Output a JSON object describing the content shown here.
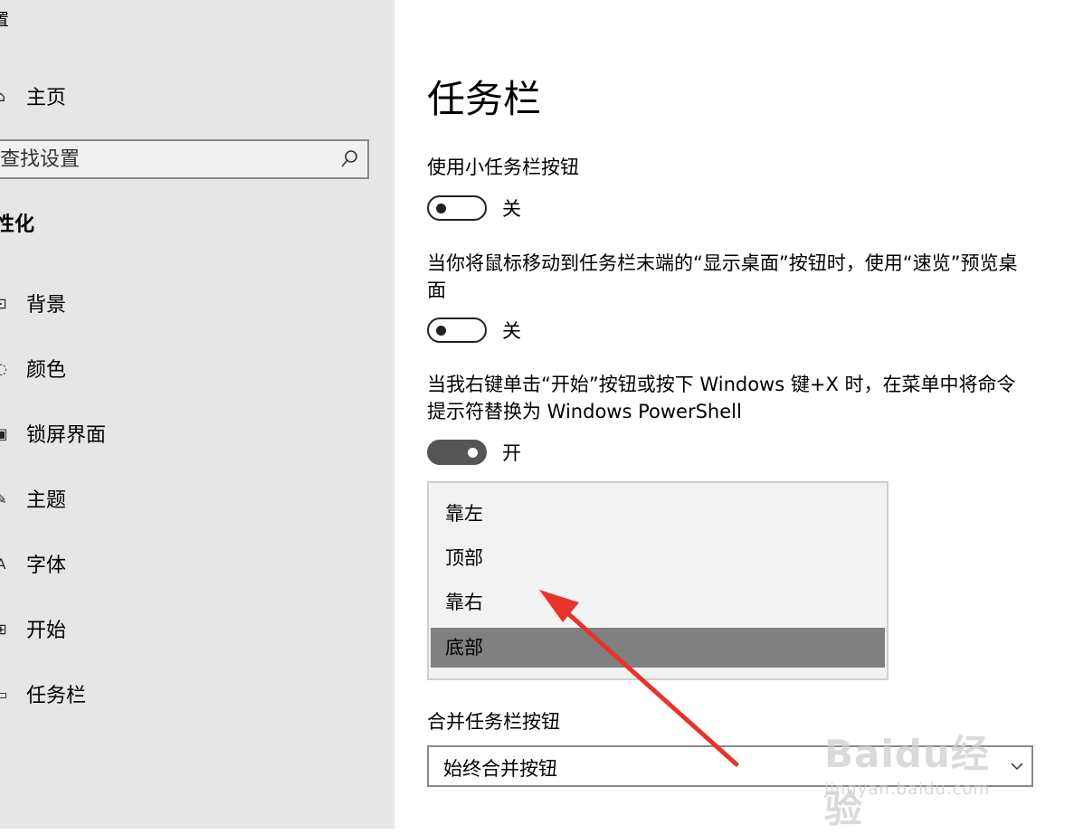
{
  "app": {
    "title": "置"
  },
  "sidebar": {
    "home_label": "主页",
    "search_placeholder": "查找设置",
    "section_title": "性化",
    "items": [
      {
        "label": "背景",
        "icon": "picture-icon"
      },
      {
        "label": "颜色",
        "icon": "palette-icon"
      },
      {
        "label": "锁屏界面",
        "icon": "lockscreen-icon"
      },
      {
        "label": "主题",
        "icon": "brush-icon"
      },
      {
        "label": "字体",
        "icon": "font-icon"
      },
      {
        "label": "开始",
        "icon": "start-icon"
      },
      {
        "label": "任务栏",
        "icon": "taskbar-icon"
      }
    ]
  },
  "main": {
    "title": "任务栏",
    "settings": [
      {
        "label": "使用小任务栏按钮",
        "state": "关",
        "on": false
      },
      {
        "label": "当你将鼠标移动到任务栏末端的“显示桌面”按钮时，使用“速览”预览桌面",
        "state": "关",
        "on": false
      },
      {
        "label": "当我右键单击“开始”按钮或按下 Windows 键+X 时，在菜单中将命令提示符替换为 Windows PowerShell",
        "state": "开",
        "on": true
      }
    ],
    "position_menu": {
      "options": [
        "靠左",
        "顶部",
        "靠右",
        "底部"
      ],
      "selected": "底部"
    },
    "combine": {
      "label": "合并任务栏按钮",
      "value": "始终合并按钮"
    }
  },
  "watermark": {
    "brand": "Baidu经验",
    "url": "jingyan.baidu.com"
  },
  "colors": {
    "sidebar_bg": "#e6e6e6",
    "selected_item": "#808080",
    "toggle_on": "#555555",
    "annotation_arrow": "#e8332a"
  }
}
